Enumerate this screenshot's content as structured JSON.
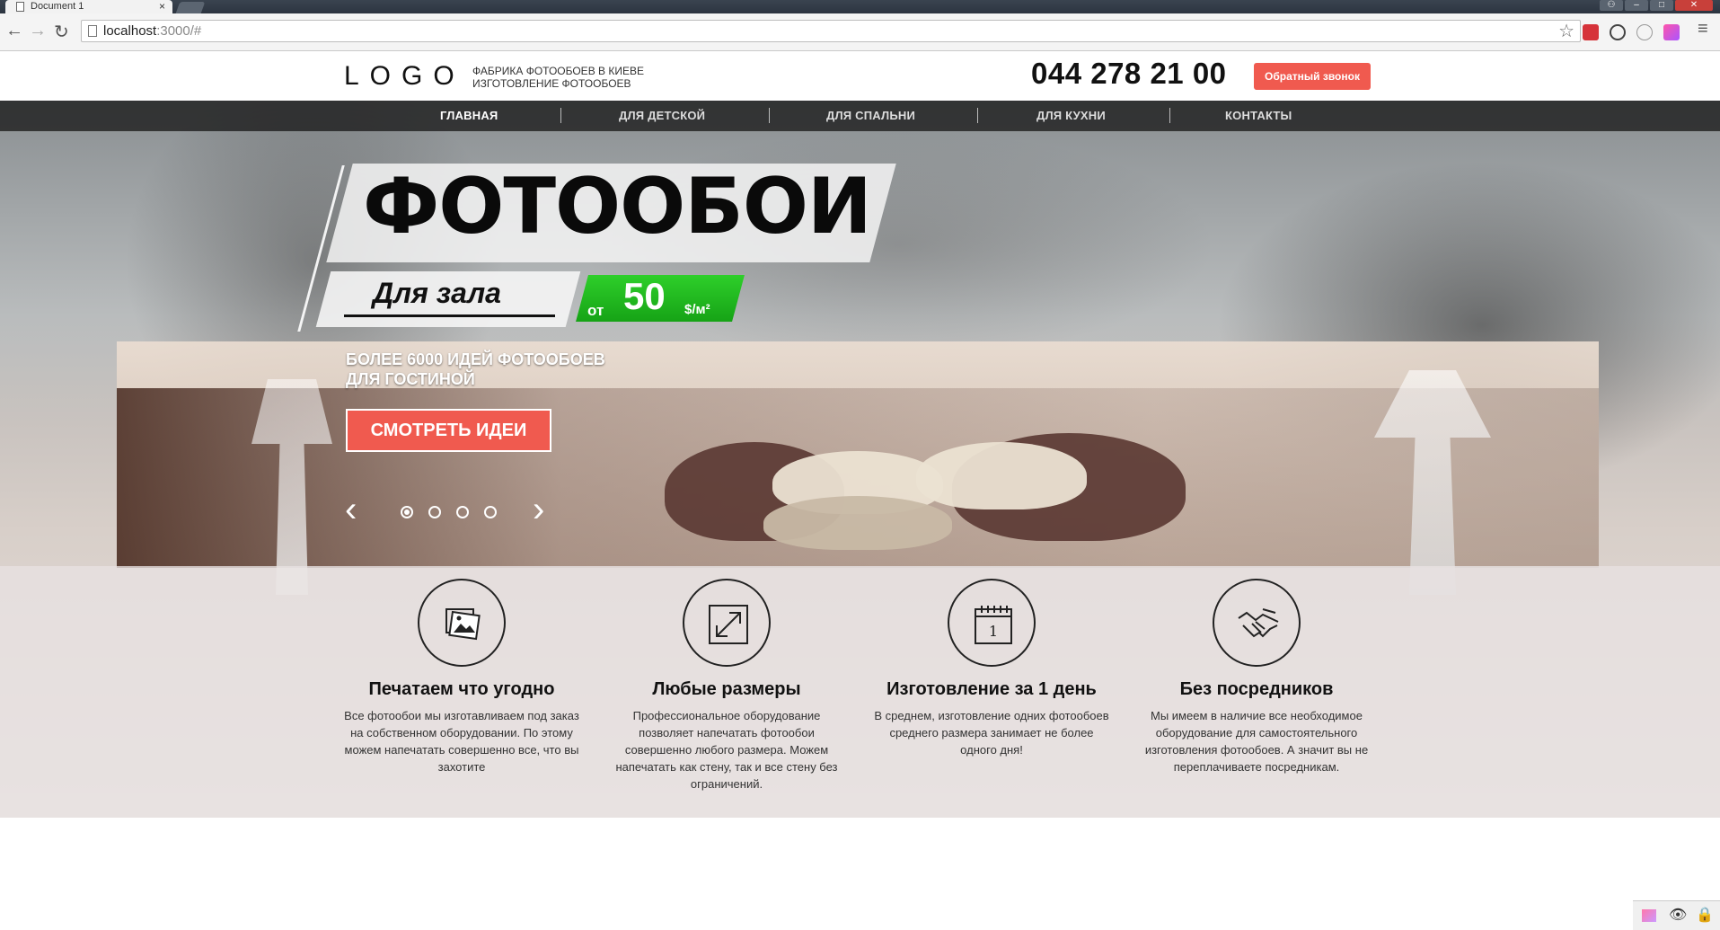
{
  "browser": {
    "tab_title": "Document 1",
    "tab_close": "×",
    "url_host": "localhost",
    "url_rest": ":3000/#"
  },
  "header": {
    "logo": "LOGO",
    "tagline_line1": "Фабрика фотообоев в Киеве",
    "tagline_line2": "Изготовление фотообоев",
    "phone": "044 278 21 00",
    "callback_label": "Обратный звонок"
  },
  "menu": {
    "items": [
      {
        "label": "Главная"
      },
      {
        "label": "Для детской"
      },
      {
        "label": "Для спальни"
      },
      {
        "label": "Для кухни"
      },
      {
        "label": "Контакты"
      }
    ]
  },
  "hero": {
    "title": "ФОТООБОИ",
    "subtitle": "Для зала",
    "price_prefix": "от",
    "price_value": "50",
    "price_unit": "$/м²",
    "desc_line1": "Более 6000 идей фотообоев",
    "desc_line2": "для гостиной",
    "cta_label": "Смотреть идеи",
    "prev_arrow": "‹",
    "next_arrow": "›",
    "slides_count": 4,
    "active_slide": 1
  },
  "features": [
    {
      "icon": "photos-icon",
      "title": "Печатаем что угодно",
      "text": "Все фотообои мы изготавливаем под заказ на собственном оборудовании. По этому можем напечатать совершенно все, что вы захотите"
    },
    {
      "icon": "resize-icon",
      "title": "Любые размеры",
      "text": "Профессиональное оборудование позволяет напечатать фотообои совершенно любого размера. Можем напечатать как стену, так и все стену без ограничений."
    },
    {
      "icon": "calendar-icon",
      "title": "Изготовление за 1 день",
      "text": "В среднем, изготовление одних фотообоев среднего размера занимает не более одного дня!"
    },
    {
      "icon": "handshake-icon",
      "title": "Без посредников",
      "text": "Мы имеем в наличие все необходимое оборудование для самостоятельного изготовления фотообоев. А значит вы не переплачиваете посредникам."
    }
  ],
  "colors": {
    "accent_red": "#f05a4f",
    "price_green": "#22b922"
  }
}
